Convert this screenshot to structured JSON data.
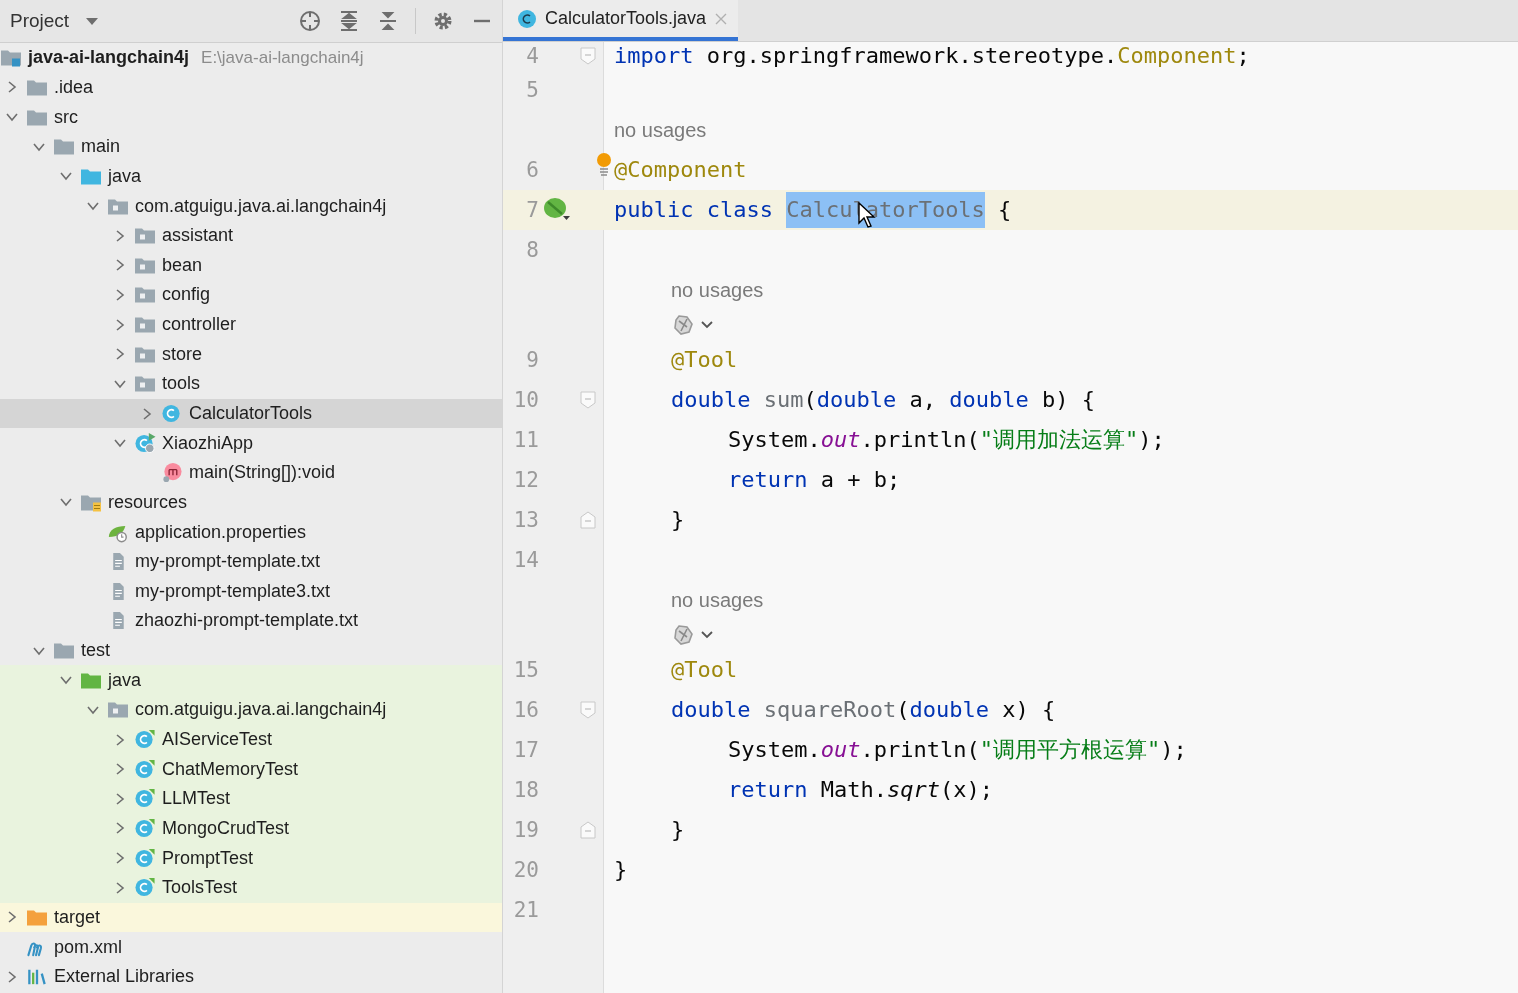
{
  "project": {
    "title": "Project",
    "tree": [
      {
        "label": "java-ai-langchain4j",
        "path": "E:\\java-ai-langchain4j",
        "kind": "module",
        "selected": false,
        "children": [
          {
            "label": ".idea",
            "kind": "folder",
            "selected": false,
            "expanded": false
          },
          {
            "label": "src",
            "kind": "folder",
            "selected": false,
            "expanded": true,
            "children": [
              {
                "label": "main",
                "kind": "folder",
                "selected": false,
                "expanded": true,
                "children": [
                  {
                    "label": "java",
                    "kind": "source-folder",
                    "selected": false,
                    "expanded": true,
                    "children": [
                      {
                        "label": "com.atguigu.java.ai.langchain4j",
                        "kind": "package",
                        "selected": false,
                        "expanded": true,
                        "children": [
                          {
                            "label": "assistant",
                            "kind": "package",
                            "selected": false,
                            "expanded": false
                          },
                          {
                            "label": "bean",
                            "kind": "package",
                            "selected": false,
                            "expanded": false
                          },
                          {
                            "label": "config",
                            "kind": "package",
                            "selected": false,
                            "expanded": false
                          },
                          {
                            "label": "controller",
                            "kind": "package",
                            "selected": false,
                            "expanded": false
                          },
                          {
                            "label": "store",
                            "kind": "package",
                            "selected": false,
                            "expanded": false
                          },
                          {
                            "label": "tools",
                            "kind": "package",
                            "selected": false,
                            "expanded": true,
                            "children": [
                              {
                                "label": "CalculatorTools",
                                "kind": "class",
                                "selected": true,
                                "expanded": false
                              }
                            ]
                          },
                          {
                            "label": "XiaozhiApp",
                            "kind": "app-class",
                            "selected": false,
                            "expanded": true,
                            "children": [
                              {
                                "label": "main(String[]):void",
                                "kind": "method",
                                "selected": false
                              }
                            ]
                          }
                        ]
                      }
                    ]
                  },
                  {
                    "label": "resources",
                    "kind": "resource-folder",
                    "selected": false,
                    "expanded": true,
                    "children": [
                      {
                        "label": "application.properties",
                        "kind": "properties",
                        "selected": false
                      },
                      {
                        "label": "my-prompt-template.txt",
                        "kind": "text-file",
                        "selected": false
                      },
                      {
                        "label": "my-prompt-template3.txt",
                        "kind": "text-file",
                        "selected": false
                      },
                      {
                        "label": "zhaozhi-prompt-template.txt",
                        "kind": "text-file",
                        "selected": false
                      }
                    ]
                  }
                ]
              },
              {
                "label": "test",
                "kind": "folder",
                "selected": false,
                "expanded": true,
                "children": [
                  {
                    "label": "java",
                    "kind": "test-folder",
                    "color": "#e9f3de",
                    "selected": false,
                    "expanded": true,
                    "children": [
                      {
                        "label": "com.atguigu.java.ai.langchain4j",
                        "kind": "package",
                        "color": "#e9f3de",
                        "selected": false,
                        "expanded": true,
                        "children": [
                          {
                            "label": "AIServiceTest",
                            "kind": "test-class",
                            "color": "#e9f3de",
                            "selected": false,
                            "expanded": false
                          },
                          {
                            "label": "ChatMemoryTest",
                            "kind": "test-class",
                            "color": "#e9f3de",
                            "selected": false,
                            "expanded": false
                          },
                          {
                            "label": "LLMTest",
                            "kind": "test-class",
                            "color": "#e9f3de",
                            "selected": false,
                            "expanded": false
                          },
                          {
                            "label": "MongoCrudTest",
                            "kind": "test-class",
                            "color": "#e9f3de",
                            "selected": false,
                            "expanded": false
                          },
                          {
                            "label": "PromptTest",
                            "kind": "test-class",
                            "color": "#e9f3de",
                            "selected": false,
                            "expanded": false
                          },
                          {
                            "label": "ToolsTest",
                            "kind": "test-class",
                            "color": "#e9f3de",
                            "selected": false,
                            "expanded": false
                          }
                        ]
                      }
                    ]
                  }
                ]
              }
            ]
          },
          {
            "label": "target",
            "kind": "excluded-folder",
            "color": "#faf7dc",
            "selected": false,
            "expanded": false
          },
          {
            "label": "pom.xml",
            "kind": "xml-file",
            "selected": false
          },
          {
            "label": "External Libraries",
            "kind": "libraries",
            "selected": false,
            "expanded": false
          }
        ]
      }
    ]
  },
  "editor": {
    "tabs": [
      {
        "label": "CalculatorTools.java",
        "selected": true
      }
    ],
    "lines": [
      {
        "kind": "code",
        "number": "4",
        "fold_start": true,
        "tokens": [
          {
            "kind": "keyword",
            "text": "import"
          },
          {
            "kind": "plain",
            "text": " org.springframework.stereotype."
          },
          {
            "kind": "annotation",
            "text": "Component"
          },
          {
            "kind": "plain",
            "text": ";"
          }
        ]
      },
      {
        "kind": "code",
        "number": "5"
      },
      {
        "kind": "inlay",
        "text": "no usages"
      },
      {
        "kind": "code",
        "number": "6",
        "bulb": true,
        "tokens": [
          {
            "kind": "annotation",
            "text": "@Component"
          }
        ]
      },
      {
        "kind": "code",
        "number": "7",
        "current": true,
        "run_marker": true,
        "pointer": true,
        "tokens": [
          {
            "kind": "keyword",
            "text": "public class "
          },
          {
            "kind": "selected",
            "text": "CalculatorTools"
          },
          {
            "kind": "plain",
            "text": " {"
          }
        ],
        "children": [
          {
            "kind": "code",
            "number": "8"
          },
          {
            "kind": "inlay",
            "text": "no usages"
          },
          {
            "kind": "inlay-icons"
          },
          {
            "kind": "code",
            "number": "9",
            "tokens": [
              {
                "kind": "annotation",
                "text": "@Tool"
              }
            ]
          },
          {
            "kind": "code",
            "number": "10",
            "fold_start": true,
            "tokens": [
              {
                "kind": "keyword",
                "text": "double "
              },
              {
                "kind": "unused",
                "text": "sum"
              },
              {
                "kind": "plain",
                "text": "("
              },
              {
                "kind": "keyword",
                "text": "double"
              },
              {
                "kind": "plain",
                "text": " a, "
              },
              {
                "kind": "keyword",
                "text": "double"
              },
              {
                "kind": "plain",
                "text": " b) {"
              }
            ],
            "children": [
              {
                "kind": "code",
                "number": "11",
                "tokens": [
                  {
                    "kind": "plain",
                    "text": "System."
                  },
                  {
                    "kind": "field",
                    "text": "out"
                  },
                  {
                    "kind": "plain",
                    "text": ".println("
                  },
                  {
                    "kind": "string",
                    "text": "\"调用加法运算\""
                  },
                  {
                    "kind": "plain",
                    "text": ");"
                  }
                ]
              },
              {
                "kind": "code",
                "number": "12",
                "tokens": [
                  {
                    "kind": "keyword",
                    "text": "return"
                  },
                  {
                    "kind": "plain",
                    "text": " a + b;"
                  }
                ]
              }
            ]
          },
          {
            "kind": "code",
            "number": "13",
            "fold_end": true,
            "tokens": [
              {
                "kind": "plain",
                "text": "}"
              }
            ]
          },
          {
            "kind": "code",
            "number": "14"
          },
          {
            "kind": "inlay",
            "text": "no usages"
          },
          {
            "kind": "inlay-icons"
          },
          {
            "kind": "code",
            "number": "15",
            "tokens": [
              {
                "kind": "annotation",
                "text": "@Tool"
              }
            ]
          },
          {
            "kind": "code",
            "number": "16",
            "fold_start": true,
            "tokens": [
              {
                "kind": "keyword",
                "text": "double "
              },
              {
                "kind": "unused",
                "text": "squareRoot"
              },
              {
                "kind": "plain",
                "text": "("
              },
              {
                "kind": "keyword",
                "text": "double"
              },
              {
                "kind": "plain",
                "text": " x) {"
              }
            ],
            "children": [
              {
                "kind": "code",
                "number": "17",
                "tokens": [
                  {
                    "kind": "plain",
                    "text": "System."
                  },
                  {
                    "kind": "field",
                    "text": "out"
                  },
                  {
                    "kind": "plain",
                    "text": ".println("
                  },
                  {
                    "kind": "string",
                    "text": "\"调用平方根运算\""
                  },
                  {
                    "kind": "plain",
                    "text": ");"
                  }
                ]
              },
              {
                "kind": "code",
                "number": "18",
                "tokens": [
                  {
                    "kind": "keyword",
                    "text": "return"
                  },
                  {
                    "kind": "plain",
                    "text": " Math."
                  },
                  {
                    "kind": "static-call",
                    "text": "sqrt"
                  },
                  {
                    "kind": "plain",
                    "text": "(x);"
                  }
                ]
              }
            ]
          },
          {
            "kind": "code",
            "number": "19",
            "fold_end": true,
            "tokens": [
              {
                "kind": "plain",
                "text": "}"
              }
            ]
          }
        ]
      },
      {
        "kind": "code",
        "number": "20",
        "tokens": [
          {
            "kind": "plain",
            "text": "}"
          }
        ]
      },
      {
        "kind": "code",
        "number": "21"
      }
    ]
  }
}
